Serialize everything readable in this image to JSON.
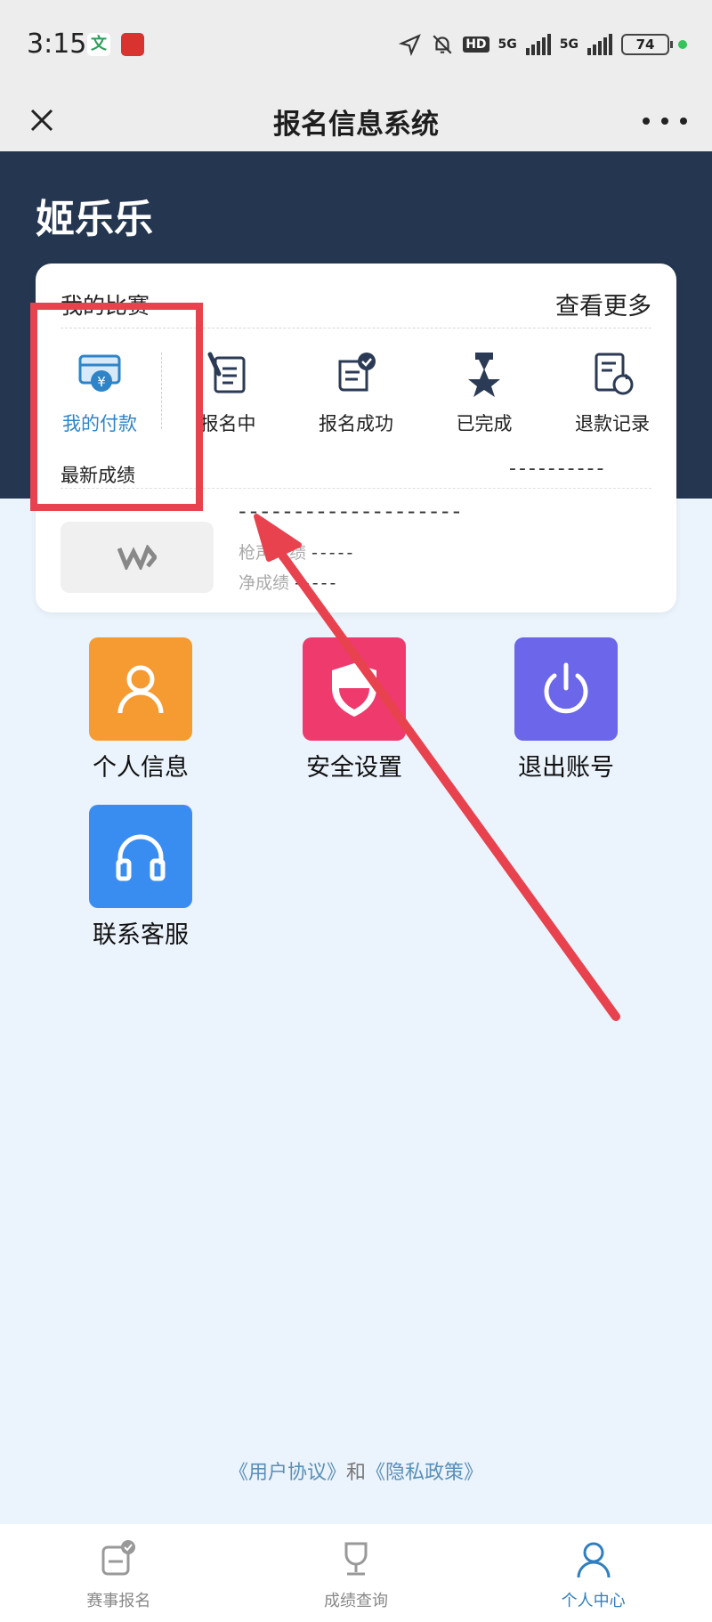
{
  "status_bar": {
    "time": "3:15",
    "app_icon_text": "文",
    "hd_label": "HD",
    "network_1": "5G",
    "network_2": "5G",
    "battery": "74"
  },
  "title_bar": {
    "title": "报名信息系统"
  },
  "user": {
    "name": "姬乐乐"
  },
  "my_races": {
    "title": "我的比赛",
    "more": "查看更多",
    "menu": [
      {
        "label": "我的付款",
        "icon": "payment-card-icon",
        "active": true
      },
      {
        "label": "报名中",
        "icon": "sign-doc-icon"
      },
      {
        "label": "报名成功",
        "icon": "certificate-check-icon"
      },
      {
        "label": "已完成",
        "icon": "medal-star-icon"
      },
      {
        "label": "退款记录",
        "icon": "refund-doc-icon"
      }
    ],
    "latest_label": "最新成绩",
    "latest_placeholder": "----------",
    "result": {
      "race_name": "--------------------",
      "gun_label": "枪声成绩",
      "gun_value": "-----",
      "net_label": "净成绩",
      "net_value": "-----"
    }
  },
  "grid_items": [
    {
      "label": "个人信息",
      "icon": "person-icon",
      "color": "#f59b31"
    },
    {
      "label": "安全设置",
      "icon": "shield-icon",
      "color": "#ef3a6e"
    },
    {
      "label": "退出账号",
      "icon": "power-icon",
      "color": "#6b66ea"
    },
    {
      "label": "联系客服",
      "icon": "headset-icon",
      "color": "#3a8df0"
    }
  ],
  "footer": {
    "user_agreement": "《用户协议》",
    "and": "和",
    "privacy_policy": "《隐私政策》"
  },
  "tabbar": [
    {
      "label": "赛事报名",
      "icon": "register-icon"
    },
    {
      "label": "成绩查询",
      "icon": "trophy-icon"
    },
    {
      "label": "个人中心",
      "icon": "user-icon",
      "active": true
    }
  ],
  "colors": {
    "header": "#253750",
    "accent": "#2f84c8",
    "highlight": "#e8424e"
  }
}
